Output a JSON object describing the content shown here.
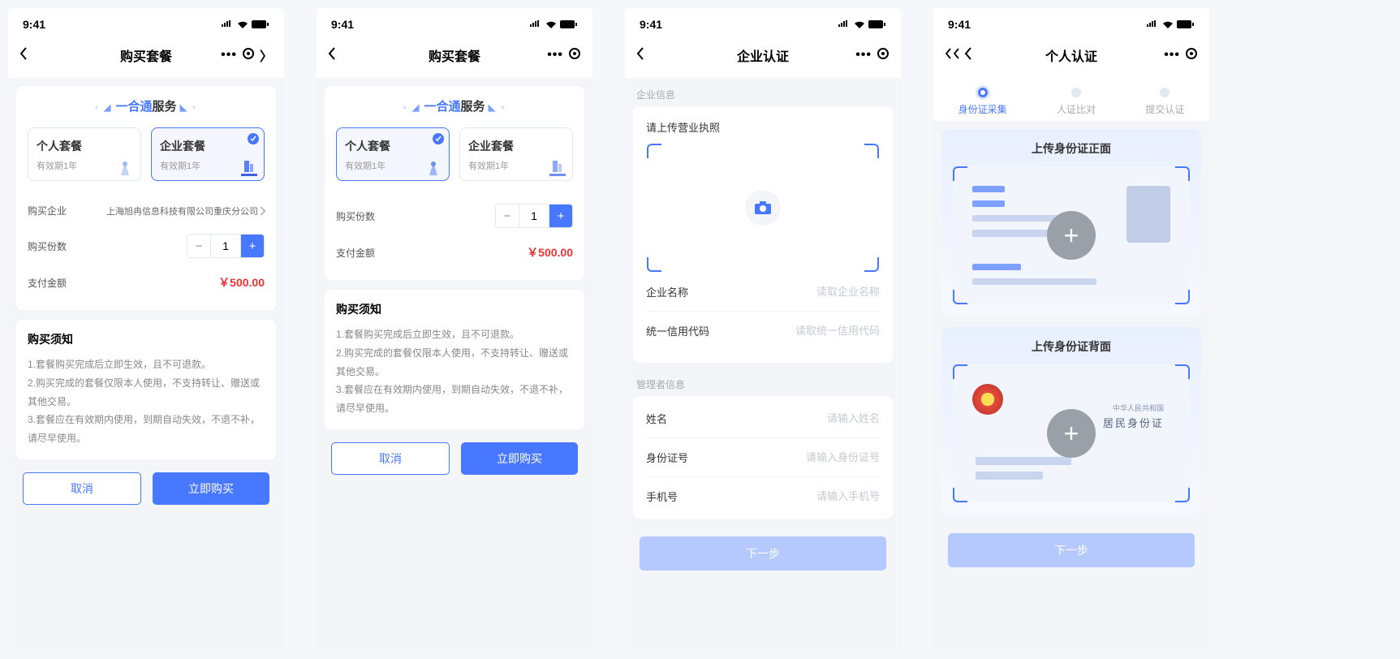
{
  "status": {
    "time": "9:41"
  },
  "screens": {
    "s1": {
      "title": "购买套餐",
      "service_brand": "一合通",
      "service_suffix": "服务",
      "plan_personal": {
        "name": "个人套餐",
        "sub": "有效期1年"
      },
      "plan_enterprise": {
        "name": "企业套餐",
        "sub": "有效期1年"
      },
      "row_company_label": "购买企业",
      "row_company_value": "上海旭冉信息科技有限公司重庆分公司",
      "row_qty_label": "购买份数",
      "qty": "1",
      "row_amount_label": "支付金额",
      "amount": "￥500.00",
      "notice_title": "购买须知",
      "notice_1": "1.套餐购买完成后立即生效，且不可退款。",
      "notice_2": "2.购买完成的套餐仅限本人使用，不支持转让、赠送或其他交易。",
      "notice_3": "3.套餐应在有效期内使用，到期自动失效，不退不补，请尽早使用。",
      "btn_cancel": "取消",
      "btn_buy": "立即购买"
    },
    "s2": {
      "title": "购买套餐",
      "row_qty_label": "购买份数",
      "qty": "1",
      "row_amount_label": "支付金额",
      "amount": "￥500.00",
      "notice_title": "购买须知",
      "notice_1": "1.套餐购买完成后立即生效，且不可退款。",
      "notice_2": "2.购买完成的套餐仅限本人使用，不支持转让、赠送或其他交易。",
      "notice_3": "3.套餐应在有效期内使用，到期自动失效，不退不补，请尽早使用。",
      "btn_cancel": "取消",
      "btn_buy": "立即购买"
    },
    "s3": {
      "title": "企业认证",
      "section_company": "企业信息",
      "upload_label": "请上传营业执照",
      "f_company_name": "企业名称",
      "f_company_name_ph": "读取企业名称",
      "f_uscc": "统一信用代码",
      "f_uscc_ph": "读取统一信用代码",
      "section_admin": "管理者信息",
      "f_name": "姓名",
      "f_name_ph": "请输入姓名",
      "f_id": "身份证号",
      "f_id_ph": "请输入身份证号",
      "f_phone": "手机号",
      "f_phone_ph": "请输入手机号",
      "btn_next": "下一步"
    },
    "s4": {
      "title": "个人认证",
      "step1": "身份证采集",
      "step2": "人证比对",
      "step3": "提交认证",
      "front_title": "上传身份证正面",
      "back_title": "上传身份证背面",
      "back_l1": "中华人民共和国",
      "back_l2": "居民身份证",
      "btn_next": "下一步"
    }
  }
}
